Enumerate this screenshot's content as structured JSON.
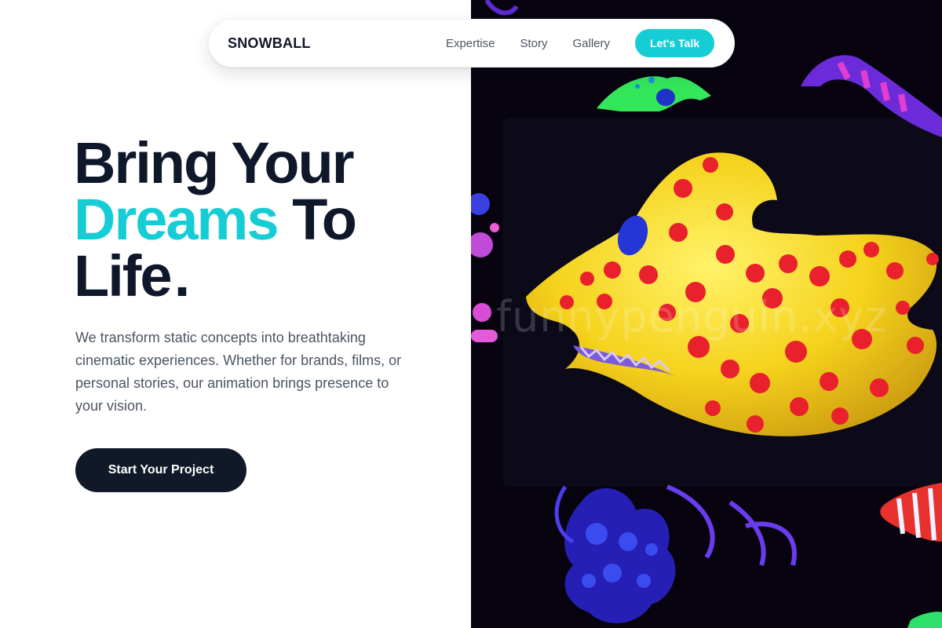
{
  "nav": {
    "brand": "SNOWBALL",
    "links": [
      "Expertise",
      "Story",
      "Gallery"
    ],
    "cta": "Let's Talk"
  },
  "hero": {
    "headline_line1": "Bring Your",
    "headline_accent": "Dreams",
    "headline_line2_rest": " To",
    "headline_line3": "Life",
    "headline_dot": ".",
    "subtitle": "We transform static concepts into breathtaking cinematic experiences. Whether for brands, films, or personal stories, our animation brings presence to your vision.",
    "button": "Start Your Project"
  },
  "image": {
    "watermark": "funnypenguin.xyz"
  },
  "colors": {
    "accent": "#16cdd6",
    "dark": "#111827",
    "image_background": "#07030f",
    "creature_yellow": "#f5d21c",
    "creature_spots": "#e8212d"
  }
}
